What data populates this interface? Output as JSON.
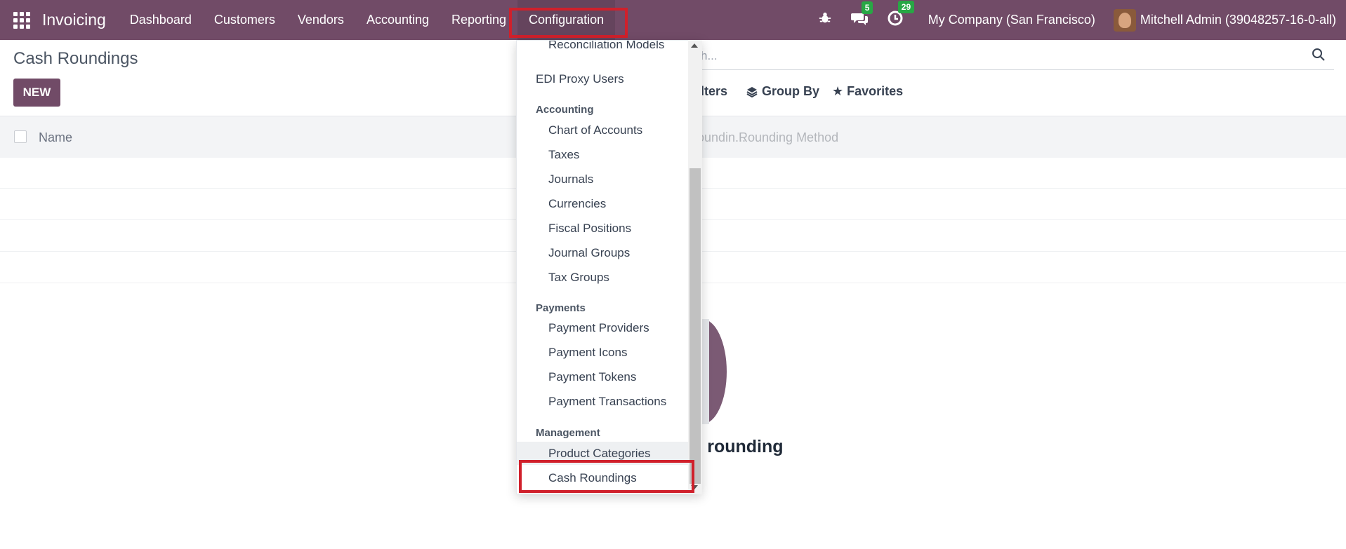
{
  "navbar": {
    "brand": "Invoicing",
    "menu": [
      "Dashboard",
      "Customers",
      "Vendors",
      "Accounting",
      "Reporting",
      "Configuration"
    ],
    "active": "Configuration",
    "messages_badge": "5",
    "activities_badge": "29",
    "company": "My Company (San Francisco)",
    "user": "Mitchell Admin (39048257-16-0-all)",
    "icons": [
      "apps-grid-icon",
      "bug-icon",
      "chat-icon",
      "clock-icon",
      "avatar"
    ]
  },
  "page": {
    "title": "Cash Roundings",
    "new_label": "NEW",
    "search_placeholder": "Search...",
    "search_visible_text": "h...",
    "filters_visible_text": "lters",
    "group_by_label": "Group By",
    "favorites_label": "Favorites",
    "columns": {
      "name": "Name",
      "rounding_truncated": "Roundin...",
      "rounding_method": "Rounding Method"
    },
    "empty_text_visible": "h rounding"
  },
  "dropdown": {
    "items_top": [
      {
        "label": "Reconciliation Models"
      },
      {
        "label": "EDI Proxy Users"
      }
    ],
    "sections": [
      {
        "title": "Accounting",
        "items": [
          "Chart of Accounts",
          "Taxes",
          "Journals",
          "Currencies",
          "Fiscal Positions",
          "Journal Groups",
          "Tax Groups"
        ]
      },
      {
        "title": "Payments",
        "items": [
          "Payment Providers",
          "Payment Icons",
          "Payment Tokens",
          "Payment Transactions"
        ]
      },
      {
        "title": "Management",
        "items": [
          "Product Categories",
          "Cash Roundings"
        ]
      }
    ],
    "highlighted_item": "Cash Roundings"
  },
  "colors": {
    "navbar": "#714b67",
    "highlight": "#d0202b",
    "badge": "#28a745"
  }
}
